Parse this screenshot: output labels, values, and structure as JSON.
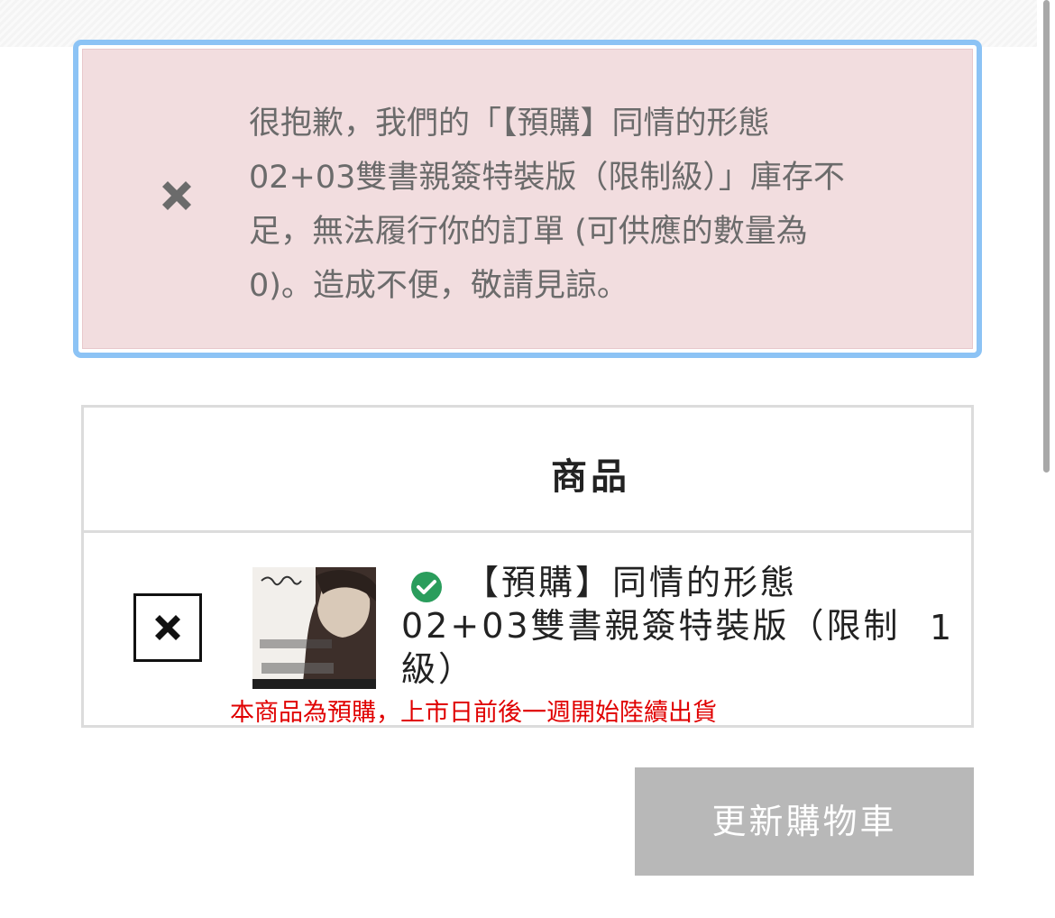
{
  "notice": {
    "icon": "close-icon",
    "message": "很抱歉，我們的「【預購】同情的形態\n02+03雙書親簽特裝版（限制級）」庫存不\n足，無法履行你的訂單 (可供應的數量為\n0)。造成不便，敬請見諒。",
    "border_color": "#8cc3f5",
    "background_color": "#f2dddf"
  },
  "cart": {
    "header": "商品",
    "items": [
      {
        "remove_icon": "close-icon",
        "thumbnail": "product-cover-image",
        "status_icon": "check-circle-icon",
        "name": "【預購】同情的形態 02+03雙書親簽特裝版（限制級）",
        "quantity": "1",
        "note": "本商品為預購，上市日前後一週開始陸續出貨"
      }
    ]
  },
  "actions": {
    "update_cart_label": "更新購物車"
  },
  "colors": {
    "success": "#2a9d5c",
    "note": "#e00000",
    "button_disabled": "#b8b8b8"
  }
}
